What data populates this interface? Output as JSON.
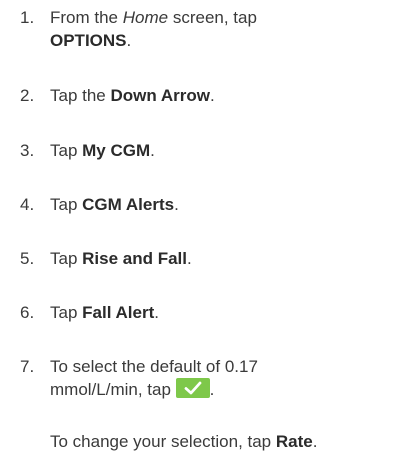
{
  "steps": [
    {
      "number": "1.",
      "parts": [
        "From the ",
        "Home",
        " screen, tap",
        "OPTIONS",
        "."
      ]
    },
    {
      "number": "2.",
      "parts": [
        "Tap the ",
        "Down Arrow",
        "."
      ]
    },
    {
      "number": "3.",
      "parts": [
        "Tap ",
        "My CGM",
        "."
      ]
    },
    {
      "number": "4.",
      "parts": [
        "Tap ",
        "CGM Alerts",
        "."
      ]
    },
    {
      "number": "5.",
      "parts": [
        "Tap ",
        "Rise and Fall",
        "."
      ]
    },
    {
      "number": "6.",
      "parts": [
        "Tap ",
        "Fall Alert",
        "."
      ]
    },
    {
      "number": "7.",
      "parts": [
        "To select the default of 0.17",
        "mmol/L/min, tap ",
        "."
      ],
      "button_icon": "checkmark-icon",
      "button_color": "#7ec84a"
    }
  ],
  "note": {
    "parts": [
      "To change your selection, tap ",
      "Rate",
      "."
    ]
  }
}
